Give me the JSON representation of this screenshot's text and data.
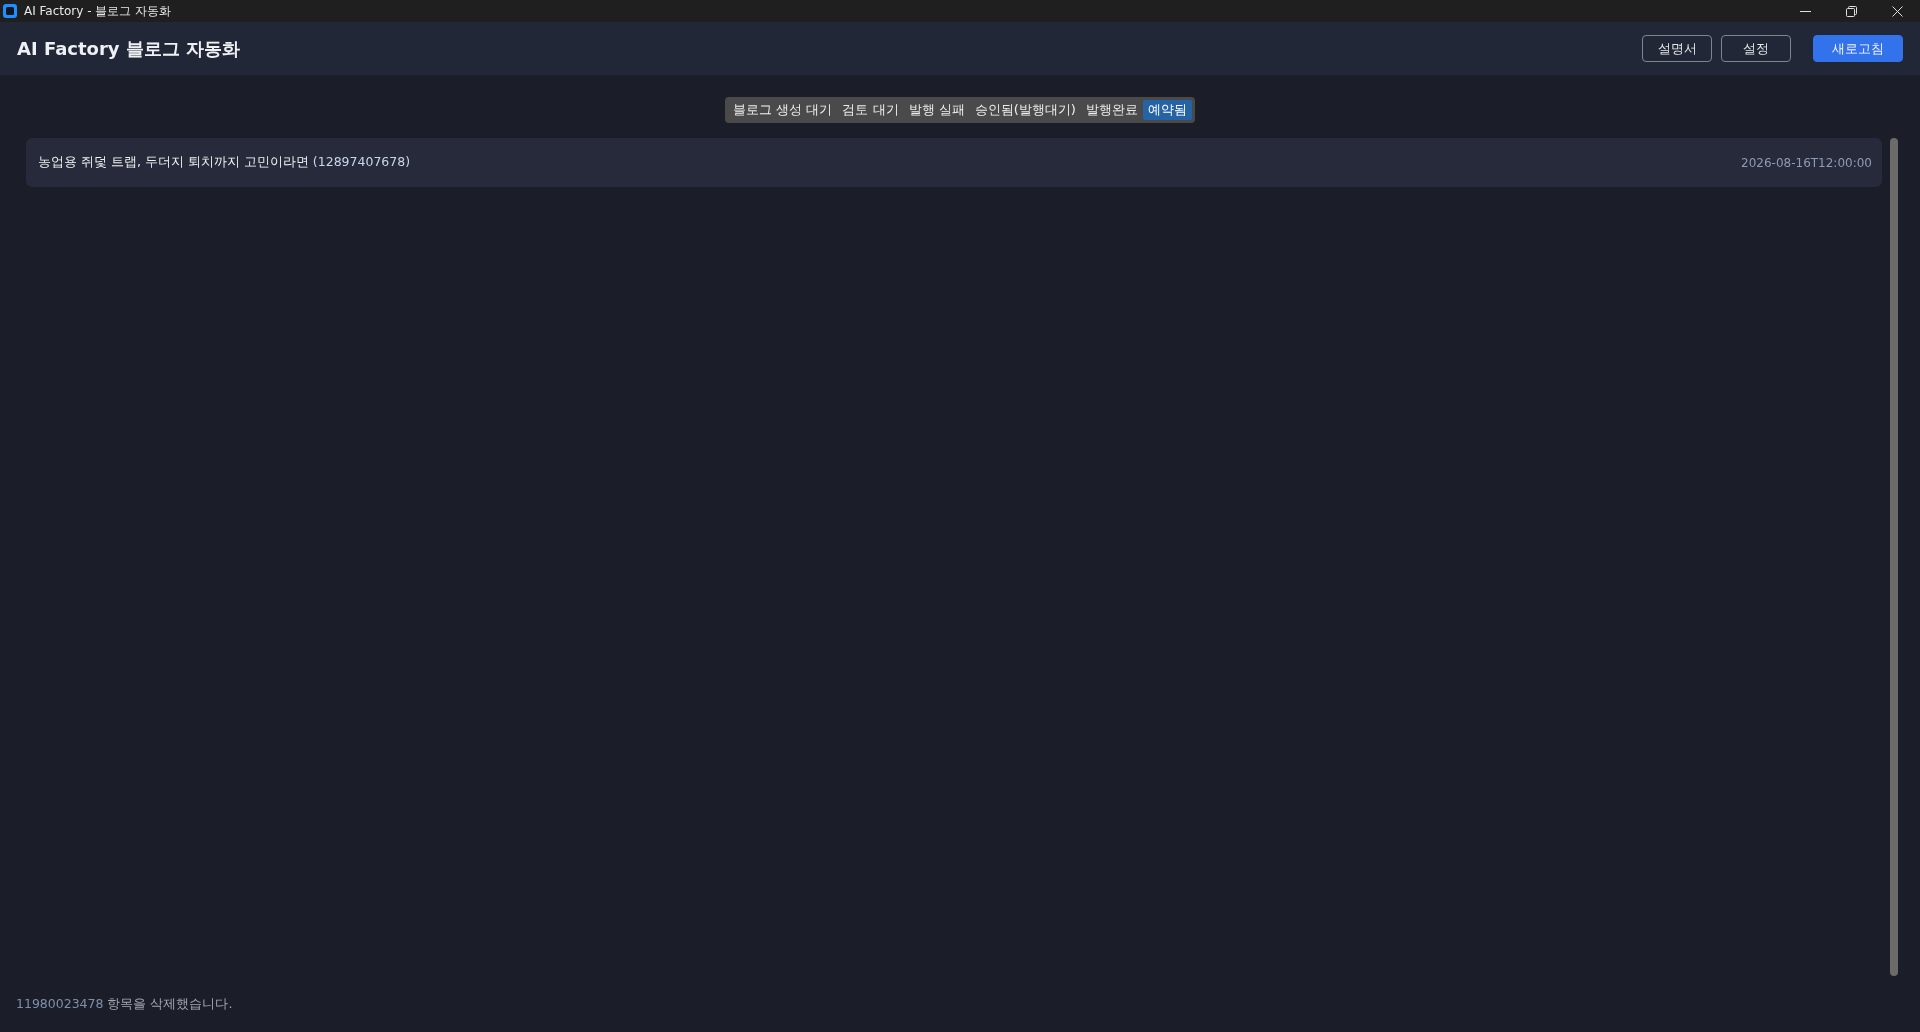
{
  "window": {
    "title": "AI Factory - 블로그 자동화"
  },
  "header": {
    "title": "AI Factory 블로그 자동화",
    "buttons": [
      {
        "label": "설명서",
        "kind": "outline"
      },
      {
        "label": "설정",
        "kind": "outline"
      },
      {
        "label": "새로고침",
        "kind": "primary"
      }
    ]
  },
  "tabs": [
    {
      "label": "블로그 생성 대기",
      "selected": false
    },
    {
      "label": "검토 대기",
      "selected": false
    },
    {
      "label": "발행 실패",
      "selected": false
    },
    {
      "label": "승인됨(발행대기)",
      "selected": false
    },
    {
      "label": "발행완료",
      "selected": false
    },
    {
      "label": "예약됨",
      "selected": true
    }
  ],
  "items": [
    {
      "title": "농업용 쥐덫 트랩, 두더지 퇴치까지 고민이라면",
      "post_id": "(12897407678)",
      "date": "2026-08-16T12:00:00"
    }
  ],
  "status_bar": {
    "item_id": "11980023478",
    "message": "항목을 삭제했습니다."
  }
}
